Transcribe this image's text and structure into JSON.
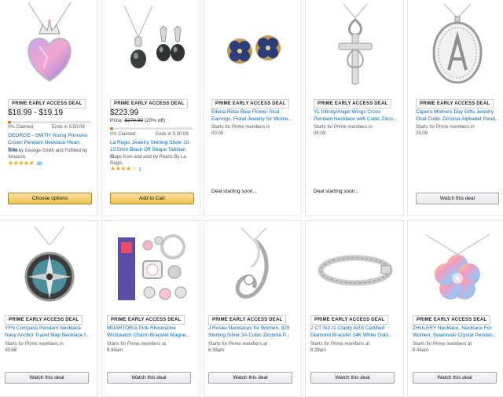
{
  "deals": [
    {
      "badge": "PRIME EARLY ACCESS DEAL",
      "price": "$18.99 - $19.19",
      "claimed": "0% Claimed",
      "ends": "Ends in 5:50:09",
      "title": "GEORGE - SMITH Young Princess Crown Pendant Necklace Heart Sha...",
      "sold_by": "Sold by George-Smith and Fulfilled by Amazon.",
      "stars": "★★★★★",
      "rating_count": "38",
      "button": "Choose options"
    },
    {
      "badge": "PRIME EARLY ACCESS DEAL",
      "price": "$223.99",
      "subprice_prefix": "Price:",
      "list_price": "$279.99",
      "discount": "(20% off)",
      "claimed": "0% Claimed",
      "ends": "Ends in 5:30:09",
      "title": "La Regis Jewelry Sterling Silver 10-10.5mm Black Off Shape Tahitian C...",
      "sold_by": "Ships from and sold by Pearls By La Regis.",
      "stars": "★★★★☆",
      "rating_count": "1",
      "button": "Add to Cart"
    },
    {
      "badge": "PRIME EARLY ACCESS DEAL",
      "title": "Ellena Rose Blue Flower Stud Earrings, Floral Jewelry for Wome...",
      "starts": "Starts for Prime members in",
      "starts_time": "00:08",
      "soon": "Deal starting soon..."
    },
    {
      "badge": "PRIME EARLY ACCESS DEAL",
      "title": "YL Infinity/Angel Wings Cross Pendant Necklace with Cubic Zirco...",
      "starts": "Starts for Prime members in",
      "starts_time": "05:09",
      "soon": "Deal starting soon..."
    },
    {
      "badge": "PRIME EARLY ACCESS DEAL",
      "title": "Capero Mothers Day Gifts Jewelry Oval Cubic Zirconia Alphabet Pend...",
      "starts": "Starts for Prime members in",
      "starts_time": "25:09",
      "button": "Watch this deal"
    },
    {
      "badge": "PRIME EARLY ACCESS DEAL",
      "title": "YFN Compass Pendant Necklace Navy Anchor Travel Map Necklace f...",
      "starts": "Starts for Prime members in",
      "starts_time": "49:58",
      "button": "Watch this deal"
    },
    {
      "badge": "PRIME EARLY ACCESS DEAL",
      "title": "MIJARTORIA Pink Rhinestone Wristwatch Charm Bracelet Magne...",
      "starts": "Starts for Prime members at",
      "starts_time": "8:34am",
      "button": "Watch this deal"
    },
    {
      "badge": "PRIME EARLY ACCESS DEAL",
      "title": "J.Rosée Necklaces for Women, 925 Sterling Silver 3A Cubic Zirconia P...",
      "starts": "Starts for Prime members at",
      "starts_time": "8:39am",
      "button": "Watch this deal"
    },
    {
      "badge": "PRIME EARLY ACCESS DEAL",
      "title": "2 CT Si2-I1 Clarity AGS Certified Diamond Bracelet 14K White Gold...",
      "starts": "Starts for Prime members at",
      "starts_time": "8:39am",
      "button": "Watch this deal"
    },
    {
      "badge": "PRIME EARLY ACCESS DEAL",
      "title": "ZHULERY Necklace, Necklace For Women, Swarovski Crystal Pendan...",
      "starts": "Starts for Prime members at",
      "starts_time": "8:44am",
      "button": "Watch this deal"
    }
  ],
  "colors": {
    "link": "#0066c0",
    "star": "#f0a41a",
    "yellow_button": "#f0c14b",
    "claim_fill": "#e47911"
  }
}
